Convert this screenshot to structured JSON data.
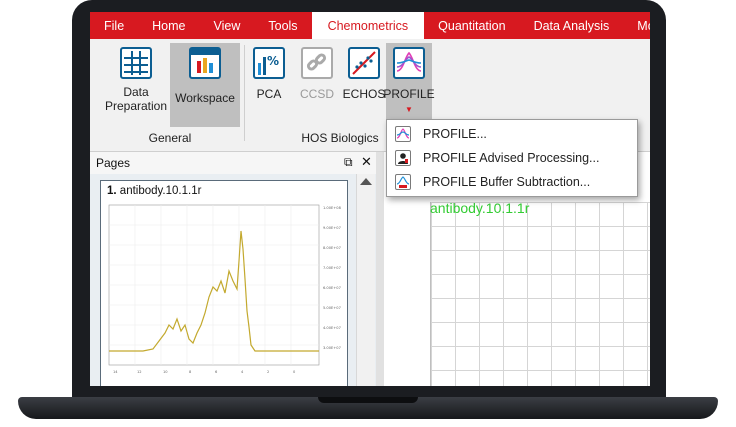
{
  "menu": {
    "items": [
      {
        "label": "File"
      },
      {
        "label": "Home"
      },
      {
        "label": "View"
      },
      {
        "label": "Tools"
      },
      {
        "label": "Chemometrics"
      },
      {
        "label": "Quantitation"
      },
      {
        "label": "Data Analysis"
      },
      {
        "label": "Mo"
      }
    ]
  },
  "ribbon": {
    "general": {
      "label": "General",
      "data_prep": "Data\nPreparation",
      "workspace": "Workspace"
    },
    "hos": {
      "label": "HOS Biologics",
      "pca": "PCA",
      "ccsd": "CCSD",
      "echos": "ECHOS",
      "profile": "PROFILE"
    }
  },
  "dropdown": {
    "items": [
      {
        "label": "PROFILE..."
      },
      {
        "label": "PROFILE Advised Processing..."
      },
      {
        "label": "PROFILE Buffer Subtraction..."
      }
    ]
  },
  "pages": {
    "title": "Pages",
    "thumb_number": "1.",
    "thumb_name": "antibody.10.1.1r"
  },
  "main": {
    "grid_label": "antibody.10.1.1r"
  },
  "colors": {
    "brand": "#d71920",
    "icon_blue": "#0c5e92",
    "plot_line": "#c3a92e",
    "label_green": "#33cc33"
  }
}
